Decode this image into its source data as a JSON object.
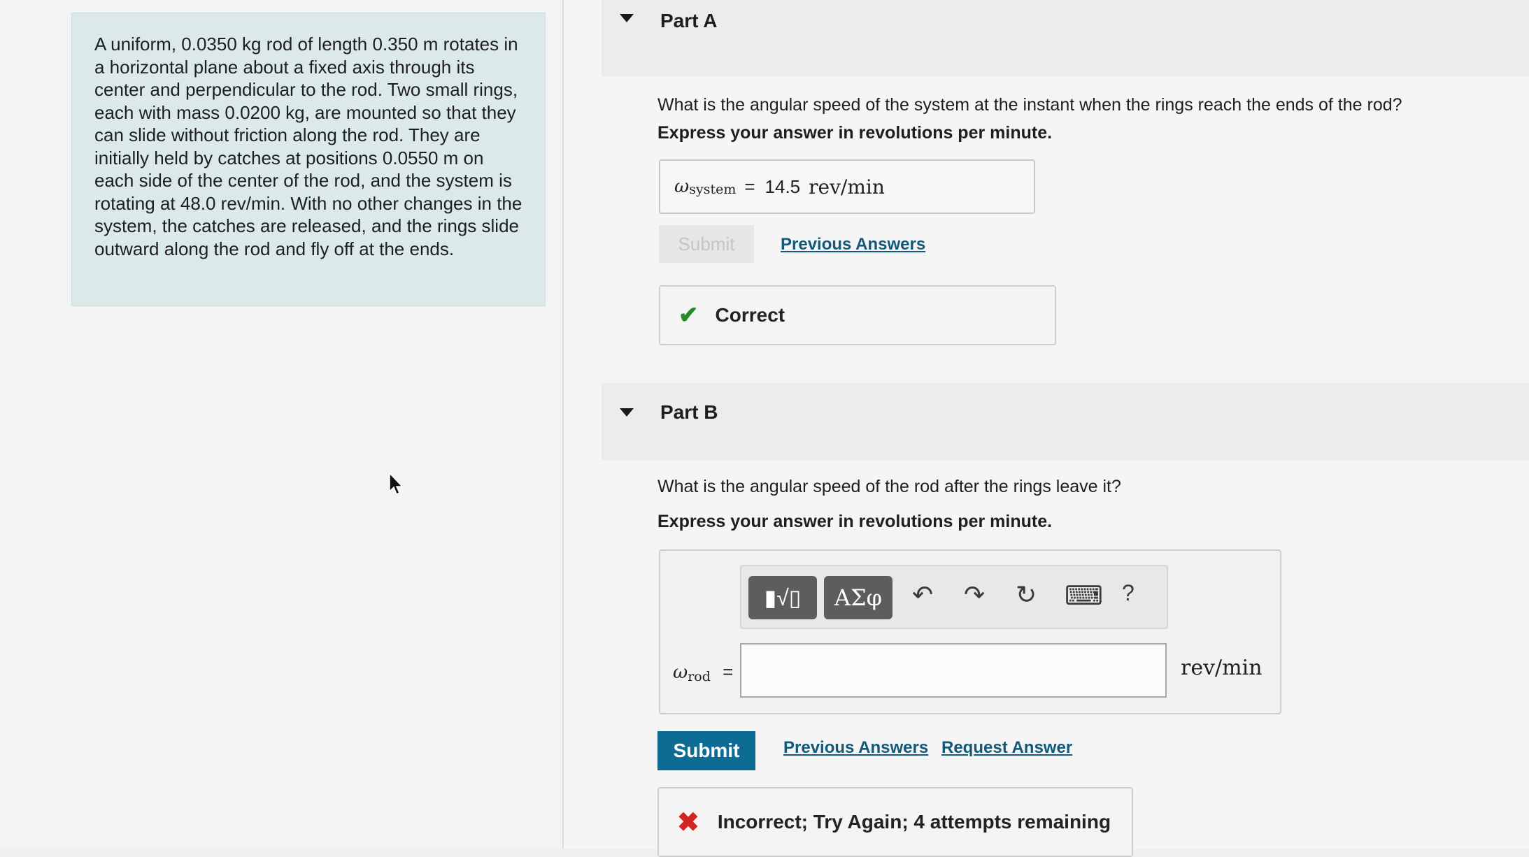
{
  "problem": {
    "text": "A uniform, 0.0350 kg rod of length 0.350 m rotates in a horizontal plane about a fixed axis through its center and perpendicular to the rod. Two small rings, each with mass 0.0200 kg, are mounted so that they can slide without friction along the rod. They are initially held by catches at positions 0.0550 m on each side of the center of the rod, and the system is rotating at 48.0 rev/min. With no other changes in the system, the catches are released, and the rings slide outward along the rod and fly off at the ends."
  },
  "partA": {
    "label": "Part A",
    "question": "What is the angular speed of the system at the instant when the rings reach the ends of the rod?",
    "instruction": "Express your answer in revolutions per minute.",
    "answer_symbol": "ω",
    "answer_subscript": "system",
    "answer_eq": "=",
    "answer_value": "14.5",
    "answer_unit": "rev/min",
    "submit_label": "Submit",
    "previous_answers_label": "Previous Answers",
    "feedback": "Correct"
  },
  "partB": {
    "label": "Part B",
    "question": "What is the angular speed of the rod after the rings leave it?",
    "instruction": "Express your answer in revolutions per minute.",
    "toolbar": {
      "templates_label": "▮√▯",
      "symbols_label": "ΑΣφ",
      "undo_icon": "↶",
      "redo_icon": "↷",
      "reset_icon": "↻",
      "keyboard_icon": "⌨",
      "help_label": "?"
    },
    "input_symbol": "ω",
    "input_subscript": "rod",
    "input_eq": "=",
    "input_value": "",
    "unit": "rev/min",
    "submit_label": "Submit",
    "previous_answers_label": "Previous Answers",
    "request_answer_label": "Request Answer",
    "feedback": "Incorrect; Try Again; 4 attempts remaining"
  },
  "colors": {
    "problem_bg": "#dce9ea",
    "submit_bg": "#0d6c93",
    "link": "#12597a",
    "correct": "#2a8a2a",
    "incorrect": "#d42323"
  }
}
